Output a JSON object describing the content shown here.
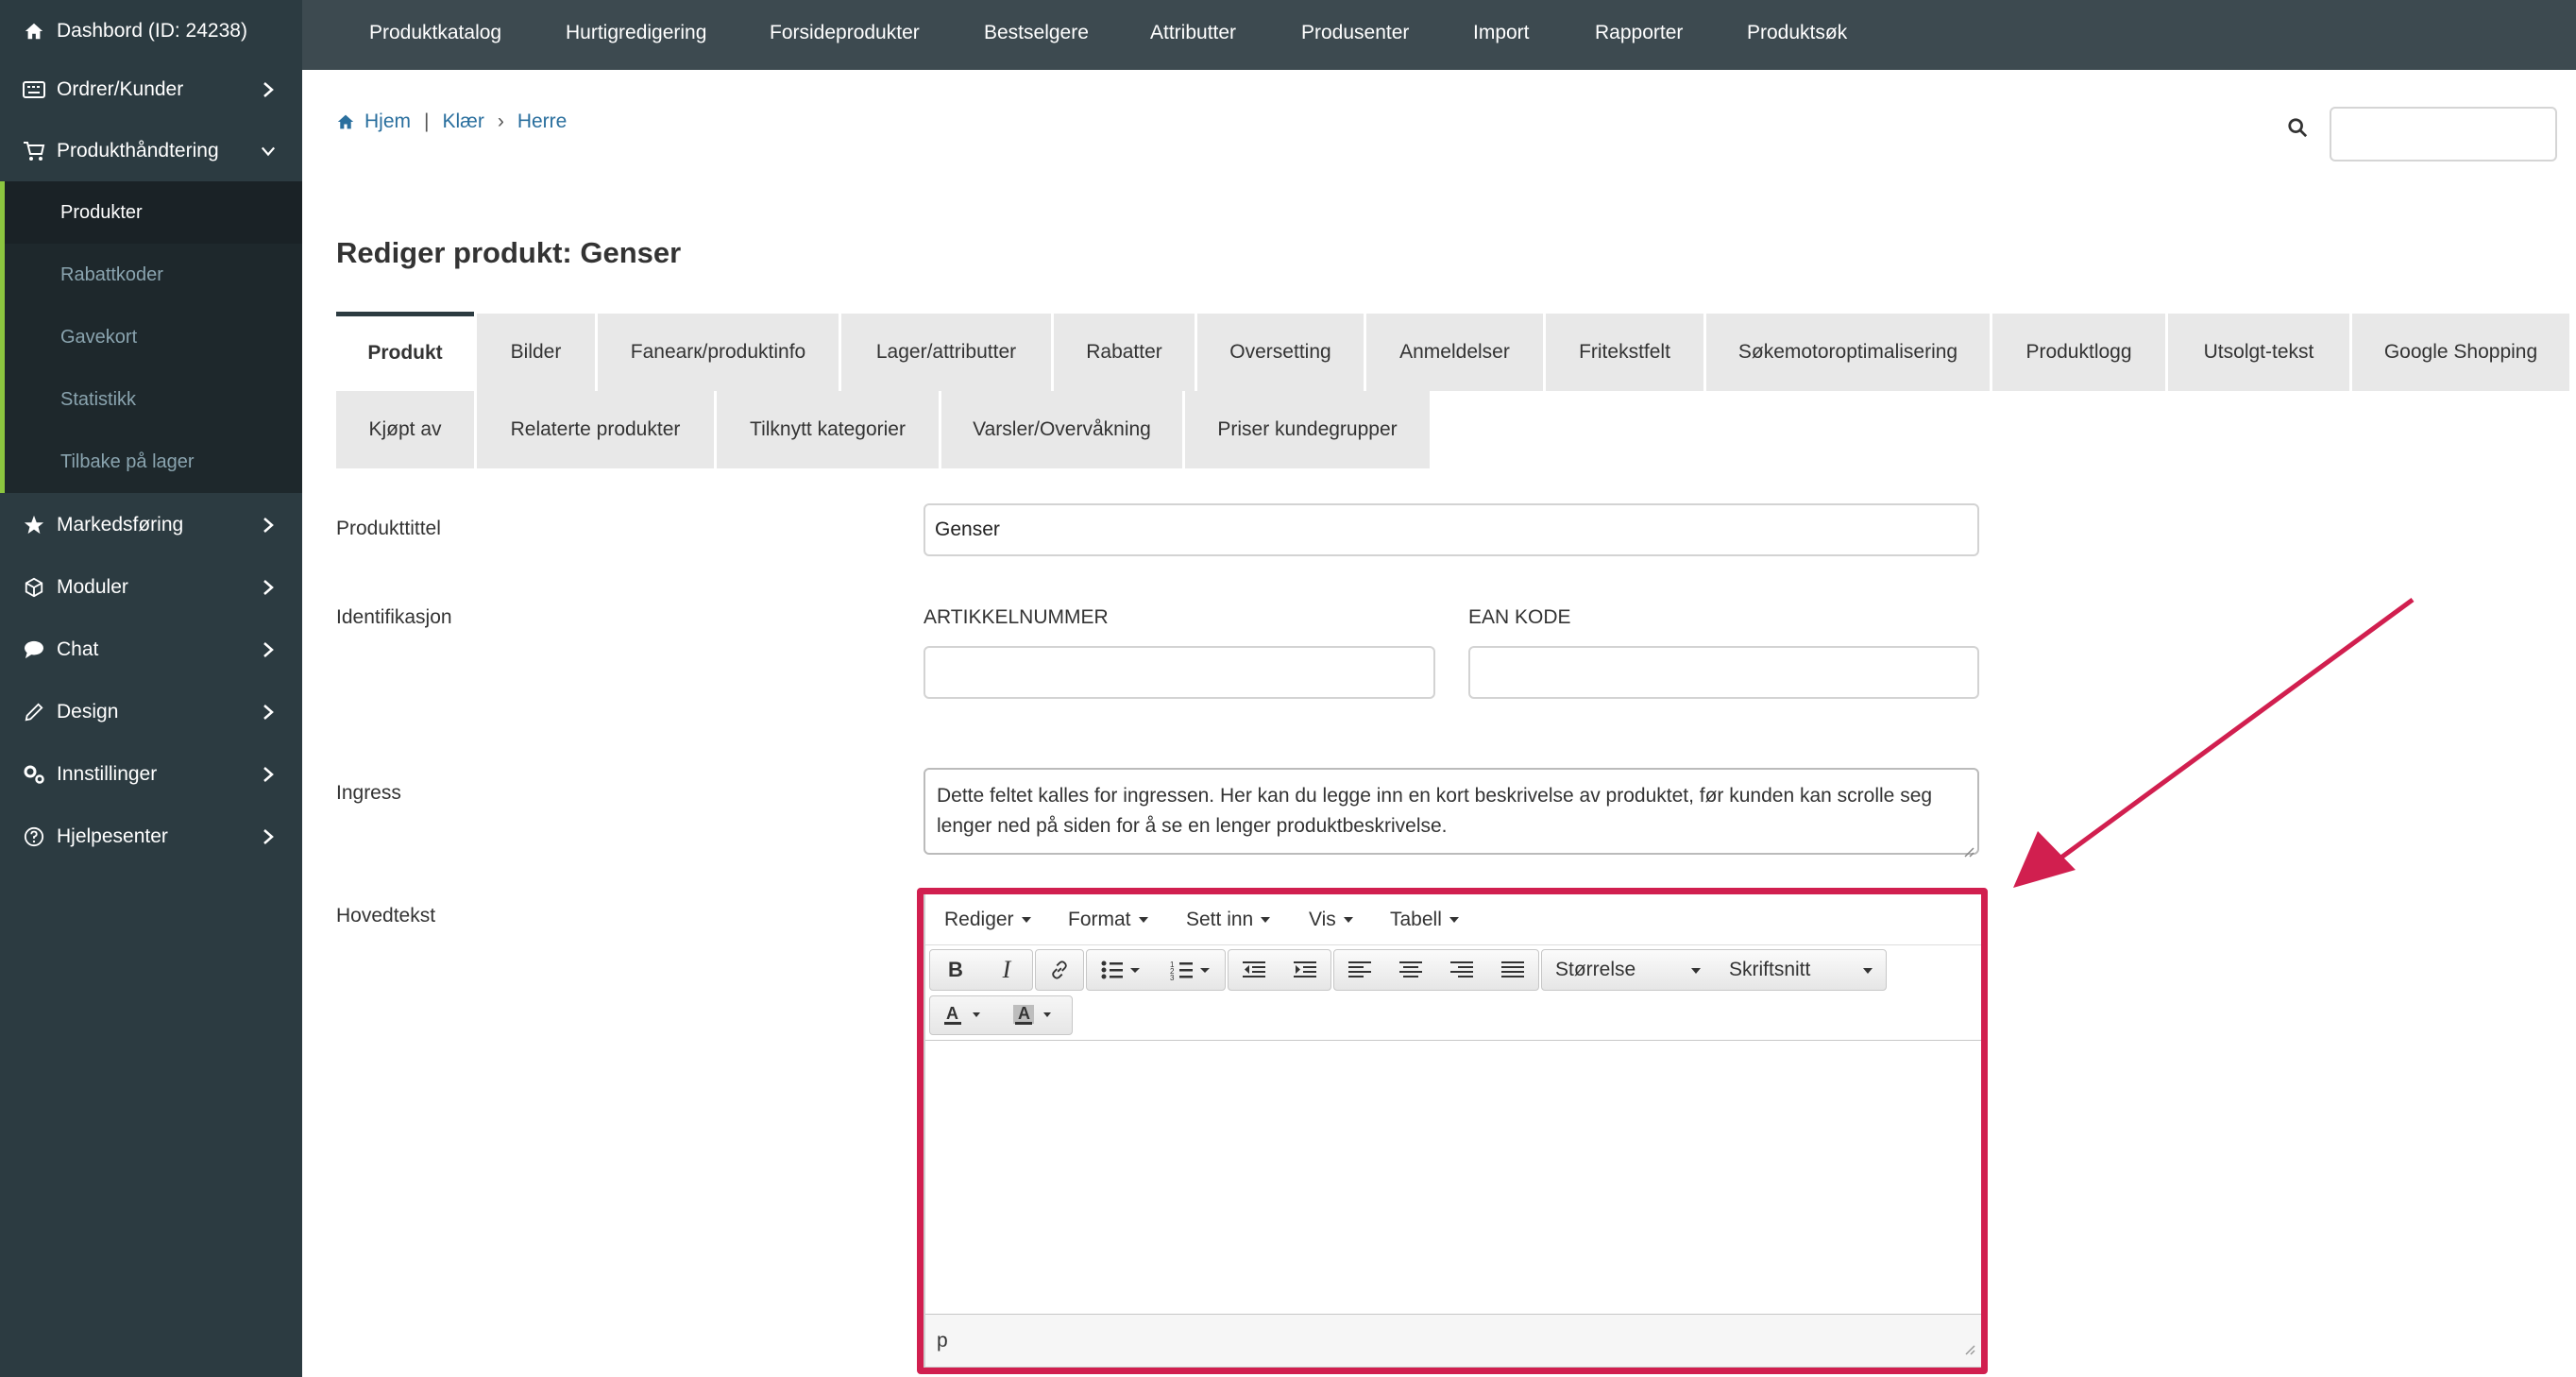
{
  "sidebar": {
    "dashboard": "Dashbord (ID: 24238)",
    "items": [
      {
        "label": "Ordrer/Kunder"
      },
      {
        "label": "Produkthåndtering"
      },
      {
        "label": "Markedsføring"
      },
      {
        "label": "Moduler"
      },
      {
        "label": "Chat"
      },
      {
        "label": "Design"
      },
      {
        "label": "Innstillinger"
      },
      {
        "label": "Hjelpesenter"
      }
    ],
    "submenu": [
      "Produkter",
      "Rabattkoder",
      "Gavekort",
      "Statistikk",
      "Tilbake på lager"
    ]
  },
  "topnav": [
    "Produktkatalog",
    "Hurtigredigering",
    "Forsideprodukter",
    "Bestselgere",
    "Attributter",
    "Produsenter",
    "Import",
    "Rapporter",
    "Produktsøk"
  ],
  "breadcrumb": {
    "home": "Hjem",
    "sep1": "|",
    "cat": "Klær",
    "sep2": "›",
    "sub": "Herre"
  },
  "page_title": "Rediger produkt: Genser",
  "tabs_row1": [
    "Produkt",
    "Bilder",
    "Fanearк/produktinfo",
    "Lager/attributter",
    "Rabatter",
    "Oversetting",
    "Anmeldelser",
    "Fritekstfelt",
    "Søkemotoroptimalisering",
    "Produktlogg",
    "Utsolgt-tekst",
    "Google Shopping"
  ],
  "tabs_row2": [
    "Kjøpt av",
    "Relaterte produkter",
    "Tilknytt kategorier",
    "Varsler/Overvåkning",
    "Priser kundegrupper"
  ],
  "form": {
    "title_label": "Produkttittel",
    "title_value": "Genser",
    "ident_label": "Identifikasjon",
    "sku_label": "ARTIKKELNUMMER",
    "sku_value": "",
    "ean_label": "EAN KODE",
    "ean_value": "",
    "ingress_label": "Ingress",
    "ingress_value": "Dette feltet kalles for ingressen. Her kan du legge inn en kort beskrivelse av produktet, før kunden kan scrolle seg lenger ned på siden for å se en lenger produktbeskrivelse.",
    "main_label": "Hovedtekst"
  },
  "editor": {
    "menus": [
      "Rediger",
      "Format",
      "Sett inn",
      "Vis",
      "Tabell"
    ],
    "size_select": "Størrelse",
    "font_select": "Skriftsnitt",
    "status_path": "p"
  },
  "colors": {
    "sidebar": "#2c3b41",
    "topbar": "#3d4a50",
    "accent": "#8cc63f",
    "highlight": "#d11f4f",
    "link": "#2a6f9e"
  }
}
